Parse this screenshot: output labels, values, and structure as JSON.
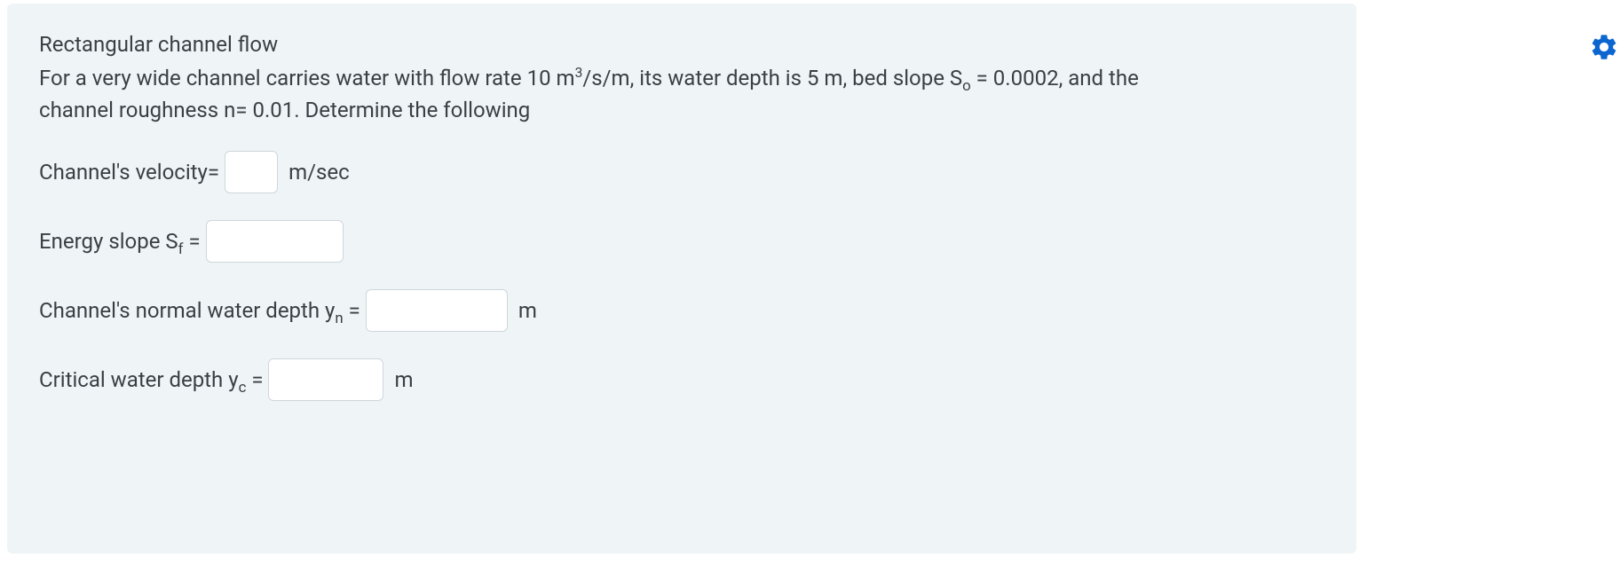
{
  "question": {
    "title": "Rectangular channel flow",
    "text_before_sup": "For a very wide channel carries water with flow rate 10 m",
    "sup": "3",
    "text_after_sup_before_so": "/s/m, its water depth is 5 m, bed slope S",
    "so_sub": "o",
    "text_after_so": " = 0.0002, and the channel roughness n= 0.01. Determine the following"
  },
  "rows": {
    "velocity": {
      "label": "Channel's velocity=",
      "unit": "m/sec",
      "value": ""
    },
    "energy_slope": {
      "label_before": "Energy slope S",
      "sub": "f",
      "label_after": " =",
      "value": ""
    },
    "normal_depth": {
      "label_before": "Channel's normal water depth y",
      "sub": "n",
      "label_after": " =",
      "unit": "m",
      "value": ""
    },
    "critical_depth": {
      "label_before": "Critical water depth y",
      "sub": "c",
      "label_after": " =",
      "unit": "m",
      "value": ""
    }
  },
  "colors": {
    "gear": "#0b66d0",
    "panel_bg": "#eff5f6",
    "text": "#3a3f44",
    "input_border": "#cfd6dc"
  }
}
